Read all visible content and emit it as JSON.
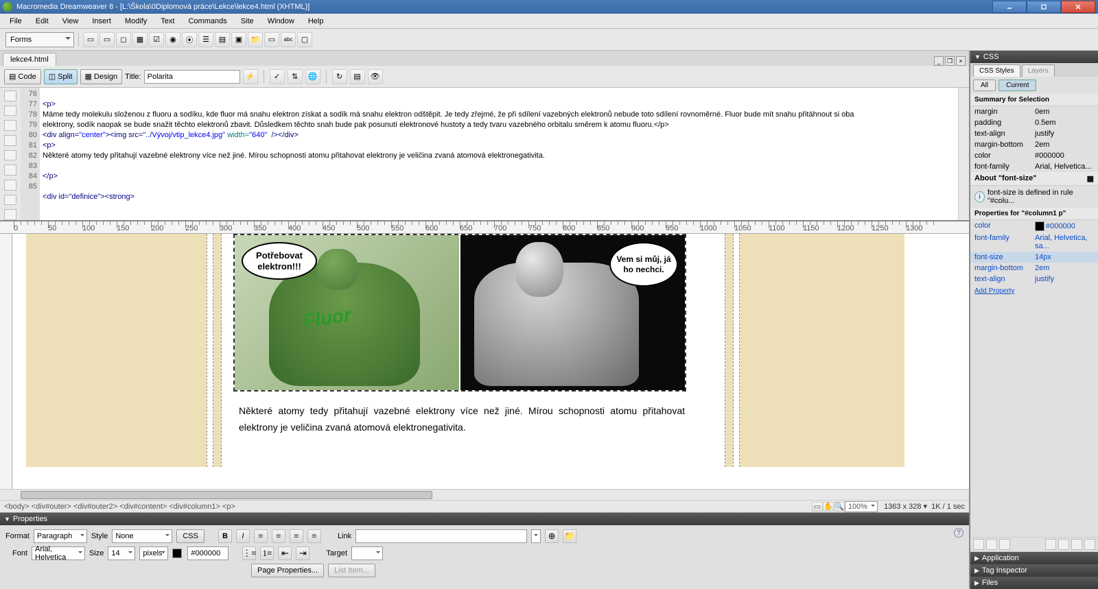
{
  "title": "Macromedia Dreamweaver 8 - [L:\\Škola\\0Diplomová práce\\Lekce\\lekce4.html (XHTML)]",
  "menu": [
    "File",
    "Edit",
    "View",
    "Insert",
    "Modify",
    "Text",
    "Commands",
    "Site",
    "Window",
    "Help"
  ],
  "toolbarCombo": "Forms",
  "docTab": "lekce4.html",
  "view": {
    "code": "Code",
    "split": "Split",
    "design": "Design",
    "titleLabel": "Title:",
    "titleValue": "Polarita"
  },
  "lines": [
    "76",
    "77",
    "78",
    "",
    "",
    "79",
    "80",
    "81",
    "",
    "82",
    "83",
    "84",
    "85"
  ],
  "code": {
    "l77": "<p>",
    "l78": "Máme tedy molekulu složenou z fluoru a sodíku, kde fluor má snahu elektron získat a sodík má snahu elektron odštěpit. Je tedy zřejmé, že při sdílení vazebných elektronů nebude toto sdílení rovnoměrné. Fluor bude mít snahu přitáhnout si oba elektrony, sodík naopak se bude snažit těchto elektronů zbavit. Důsledkem těchto snah bude pak posunutí elektronové hustoty a tedy tvaru vazebného orbitalu směrem k atomu fluoru.</p>",
    "l79a": "<div align=",
    "l79b": "\"center\"",
    "l79c": "><img src=",
    "l79d": "\"../Vývoj/vtip_lekce4.jpg\"",
    "l79e": " width=",
    "l79f": "\"640\"",
    "l79g": "  /></div>",
    "l80": "<p>",
    "l81": "Některé atomy tedy přitahují vazebné elektrony více než jiné. Mírou schopnosti atomu přitahovat elektrony je veličina zvaná atomová elektronegativita.",
    "l83": "</p>",
    "l85": "<div id=\"definice\"><strong>"
  },
  "rulerMarks": [
    0,
    50,
    100,
    150,
    200,
    250,
    300,
    350,
    400,
    450,
    500,
    550,
    600,
    650,
    700,
    750,
    800,
    850,
    900,
    950,
    1000,
    1050,
    1100,
    1150,
    1200,
    1250,
    1300
  ],
  "bubbles": {
    "hulk": "Potřebovat elektron!!!",
    "hulkLabel": "Fluor",
    "surfer": "Vem si můj, já ho nechci."
  },
  "paraText": "Některé atomy tedy přitahují vazebné elektrony více než jiné. Mírou schopnosti atomu přitahovat elektrony je veličina zvaná atomová elektronegativita.",
  "tagPath": "<body>  <div#outer>  <div#outer2>  <div#content>  <div#column1>  <p>",
  "status": {
    "zoom": "100%",
    "dim": "1363 x 328",
    "size": "1K / 1 sec"
  },
  "props": {
    "header": "Properties",
    "formatLabel": "Format",
    "formatVal": "Paragraph",
    "styleLabel": "Style",
    "styleVal": "None",
    "cssBtn": "CSS",
    "linkLabel": "Link",
    "fontLabel": "Font",
    "fontVal": "Arial, Helvetica",
    "sizeLabel": "Size",
    "sizeVal": "14",
    "sizeUnit": "pixels",
    "colorVal": "#000000",
    "targetLabel": "Target",
    "pagePropsBtn": "Page Properties...",
    "listItemBtn": "List Item..."
  },
  "css": {
    "panel": "CSS",
    "tabStyles": "CSS Styles",
    "tabLayers": "Layers",
    "btnAll": "All",
    "btnCurrent": "Current",
    "summaryHdr": "Summary for Selection",
    "summary": [
      {
        "k": "margin",
        "v": "0em"
      },
      {
        "k": "padding",
        "v": "0.5em"
      },
      {
        "k": "text-align",
        "v": "justify"
      },
      {
        "k": "margin-bottom",
        "v": "2em"
      },
      {
        "k": "color",
        "v": "#000000"
      },
      {
        "k": "font-family",
        "v": "Arial, Helvetica..."
      }
    ],
    "aboutHdr": "About \"font-size\"",
    "aboutTxt": "font-size is defined in rule \"#colu...",
    "propsHdr": "Properties for \"#column1 p\"",
    "propsList": [
      {
        "k": "color",
        "v": "#000000",
        "sw": true
      },
      {
        "k": "font-family",
        "v": "Arial, Helvetica, sa..."
      },
      {
        "k": "font-size",
        "v": "14px",
        "sel": true
      },
      {
        "k": "margin-bottom",
        "v": "2em"
      },
      {
        "k": "text-align",
        "v": "justify"
      }
    ],
    "addProp": "Add Property",
    "collapsed": [
      "Application",
      "Tag Inspector",
      "Files"
    ]
  }
}
